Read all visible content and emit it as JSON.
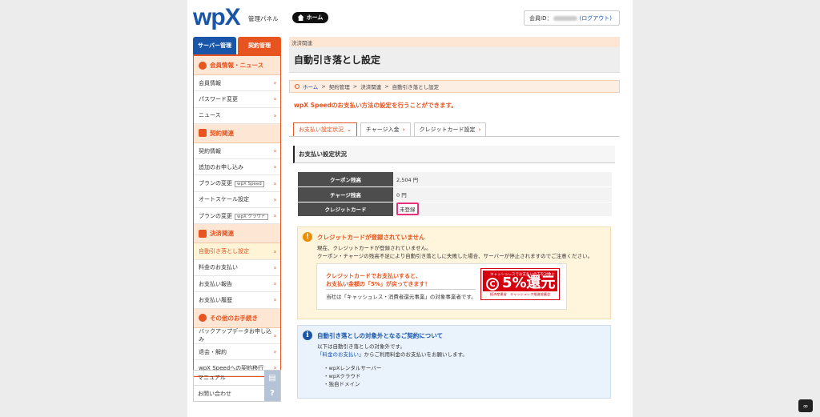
{
  "header": {
    "logo": "wpX",
    "logo_sub": "管理パネル",
    "home_label": "ホーム",
    "member_prefix": "会員ID：",
    "logout_label": "(ログアウト)"
  },
  "sidebar": {
    "tabs": [
      "サーバー管理",
      "契約管理"
    ],
    "sections": [
      {
        "title": "会員情報・ニュース",
        "items": [
          "会員情報",
          "パスワード変更",
          "ニュース"
        ]
      },
      {
        "title": "契約関連",
        "items": [
          "契約情報",
          "追加のお申し込み",
          "プランの変更",
          "オートスケール設定",
          "プランの変更"
        ]
      },
      {
        "title": "決済関連",
        "items": [
          "自動引き落とし設定",
          "料金のお支払い",
          "お支払い報告",
          "お支払い履歴"
        ]
      },
      {
        "title": "その他のお手続き",
        "items": [
          "バックアップデータお申し込み",
          "退会・解約",
          "wpX Speedへの契約移行"
        ]
      }
    ],
    "tags": [
      "wpX Speed",
      "wpX クラウド"
    ],
    "util": [
      "マニュアル",
      "お問い合わせ"
    ]
  },
  "main": {
    "section_label": "決済関連",
    "page_title": "自動引き落とし設定",
    "breadcrumb": [
      "ホーム",
      "契約管理",
      "決済関連",
      "自動引き落とし設定"
    ],
    "notice": "wpX Speedのお支払い方法の設定を行うことができます。",
    "tabs": [
      "お支払い設定状況",
      "チャージ入金",
      "クレジットカード設定"
    ],
    "panel_title": "お支払い設定状況",
    "status": {
      "coupon_label": "クーポン残高",
      "coupon_value": "2,504 円",
      "charge_label": "チャージ残高",
      "charge_value": "0 円",
      "card_label": "クレジットカード",
      "card_value": "未登録"
    },
    "warning": {
      "title": "クレジットカードが登録されていません",
      "line1": "現在、クレジットカードが登録されていません。",
      "line2": "クーポン・チャージの残高不足により自動引き落としに失敗した場合、サーバーが停止されますのでご注意ください。",
      "cashless_l1": "クレジットカードでお支払いすると、",
      "cashless_l2": "お支払い金額の「5%」が戻ってきます！",
      "cashless_l3": "当社は「キャッシュレス・消費者還元事業」の対象事業者です。",
      "banner_top": "キャッシュレスでお支払いの方を対象に",
      "banner_c": "C",
      "banner_big": "5%還元",
      "banner_bottom": "経済産業省　キャッシュレス推進協議会"
    },
    "info": {
      "title": "自動引き落としの対象外となるご契約について",
      "line1": "以下は自動引き落としの対象外です。",
      "link": "「料金のお支払い」",
      "line2_rest": "からご利用料金のお支払いをお願いします。",
      "items": [
        "・wpXレンタルサーバー",
        "・wpXクラウド",
        "・独自ドメイン"
      ]
    }
  },
  "colors": {
    "accent": "#e8541f",
    "brand": "#1a56a8",
    "highlight": "#e6327e"
  }
}
